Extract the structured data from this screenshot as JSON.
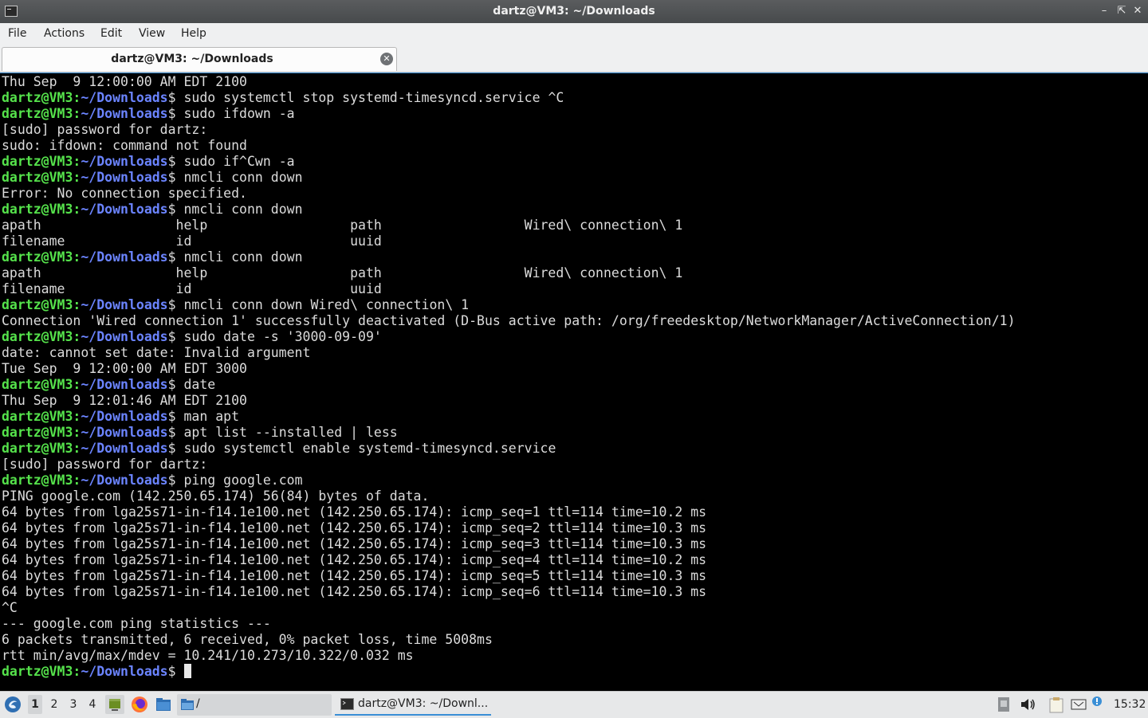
{
  "window": {
    "title": "dartz@VM3: ~/Downloads"
  },
  "menu": {
    "file": "File",
    "actions": "Actions",
    "edit": "Edit",
    "view": "View",
    "help": "Help"
  },
  "tab": {
    "label": "dartz@VM3: ~/Downloads"
  },
  "prompt": {
    "user": "dartz@VM3",
    "path": "~/Downloads"
  },
  "terminal_lines": [
    {
      "type": "out",
      "text": "Thu Sep  9 12:00:00 AM EDT 2100"
    },
    {
      "type": "cmd",
      "text": " sudo systemctl stop systemd-timesyncd.service ^C"
    },
    {
      "type": "cmd",
      "text": " sudo ifdown -a"
    },
    {
      "type": "out",
      "text": "[sudo] password for dartz:"
    },
    {
      "type": "out",
      "text": "sudo: ifdown: command not found"
    },
    {
      "type": "cmd",
      "text": " sudo if^Cwn -a"
    },
    {
      "type": "cmd",
      "text": " nmcli conn down"
    },
    {
      "type": "out",
      "text": "Error: No connection specified."
    },
    {
      "type": "cmd",
      "text": " nmcli conn down"
    },
    {
      "type": "out",
      "text": "apath                 help                  path                  Wired\\ connection\\ 1"
    },
    {
      "type": "out",
      "text": "filename              id                    uuid"
    },
    {
      "type": "cmd",
      "text": " nmcli conn down"
    },
    {
      "type": "out",
      "text": "apath                 help                  path                  Wired\\ connection\\ 1"
    },
    {
      "type": "out",
      "text": "filename              id                    uuid"
    },
    {
      "type": "cmd",
      "text": " nmcli conn down Wired\\ connection\\ 1"
    },
    {
      "type": "out",
      "text": "Connection 'Wired connection 1' successfully deactivated (D-Bus active path: /org/freedesktop/NetworkManager/ActiveConnection/1)"
    },
    {
      "type": "cmd",
      "text": " sudo date -s '3000-09-09'"
    },
    {
      "type": "out",
      "text": "date: cannot set date: Invalid argument"
    },
    {
      "type": "out",
      "text": "Tue Sep  9 12:00:00 AM EDT 3000"
    },
    {
      "type": "cmd",
      "text": " date"
    },
    {
      "type": "out",
      "text": "Thu Sep  9 12:01:46 AM EDT 2100"
    },
    {
      "type": "cmd",
      "text": " man apt"
    },
    {
      "type": "cmd",
      "text": " apt list --installed | less"
    },
    {
      "type": "cmd",
      "text": " sudo systemctl enable systemd-timesyncd.service"
    },
    {
      "type": "out",
      "text": "[sudo] password for dartz:"
    },
    {
      "type": "cmd",
      "text": " ping google.com"
    },
    {
      "type": "out",
      "text": "PING google.com (142.250.65.174) 56(84) bytes of data."
    },
    {
      "type": "out",
      "text": "64 bytes from lga25s71-in-f14.1e100.net (142.250.65.174): icmp_seq=1 ttl=114 time=10.2 ms"
    },
    {
      "type": "out",
      "text": "64 bytes from lga25s71-in-f14.1e100.net (142.250.65.174): icmp_seq=2 ttl=114 time=10.3 ms"
    },
    {
      "type": "out",
      "text": "64 bytes from lga25s71-in-f14.1e100.net (142.250.65.174): icmp_seq=3 ttl=114 time=10.3 ms"
    },
    {
      "type": "out",
      "text": "64 bytes from lga25s71-in-f14.1e100.net (142.250.65.174): icmp_seq=4 ttl=114 time=10.2 ms"
    },
    {
      "type": "out",
      "text": "64 bytes from lga25s71-in-f14.1e100.net (142.250.65.174): icmp_seq=5 ttl=114 time=10.3 ms"
    },
    {
      "type": "out",
      "text": "64 bytes from lga25s71-in-f14.1e100.net (142.250.65.174): icmp_seq=6 ttl=114 time=10.3 ms"
    },
    {
      "type": "out",
      "text": "^C"
    },
    {
      "type": "out",
      "text": "--- google.com ping statistics ---"
    },
    {
      "type": "out",
      "text": "6 packets transmitted, 6 received, 0% packet loss, time 5008ms"
    },
    {
      "type": "out",
      "text": "rtt min/avg/max/mdev = 10.241/10.273/10.322/0.032 ms"
    },
    {
      "type": "cmd",
      "text": " ",
      "cursor": true
    }
  ],
  "taskbar": {
    "workspaces": [
      "1",
      "2",
      "3",
      "4"
    ],
    "active_workspace": "1",
    "folder_task": "/",
    "terminal_task": "dartz@VM3: ~/Downl...",
    "clock": "15:32"
  },
  "colors": {
    "prompt_user": "#55e24b",
    "prompt_path": "#6b84ff",
    "accent": "#3a8fd6"
  }
}
